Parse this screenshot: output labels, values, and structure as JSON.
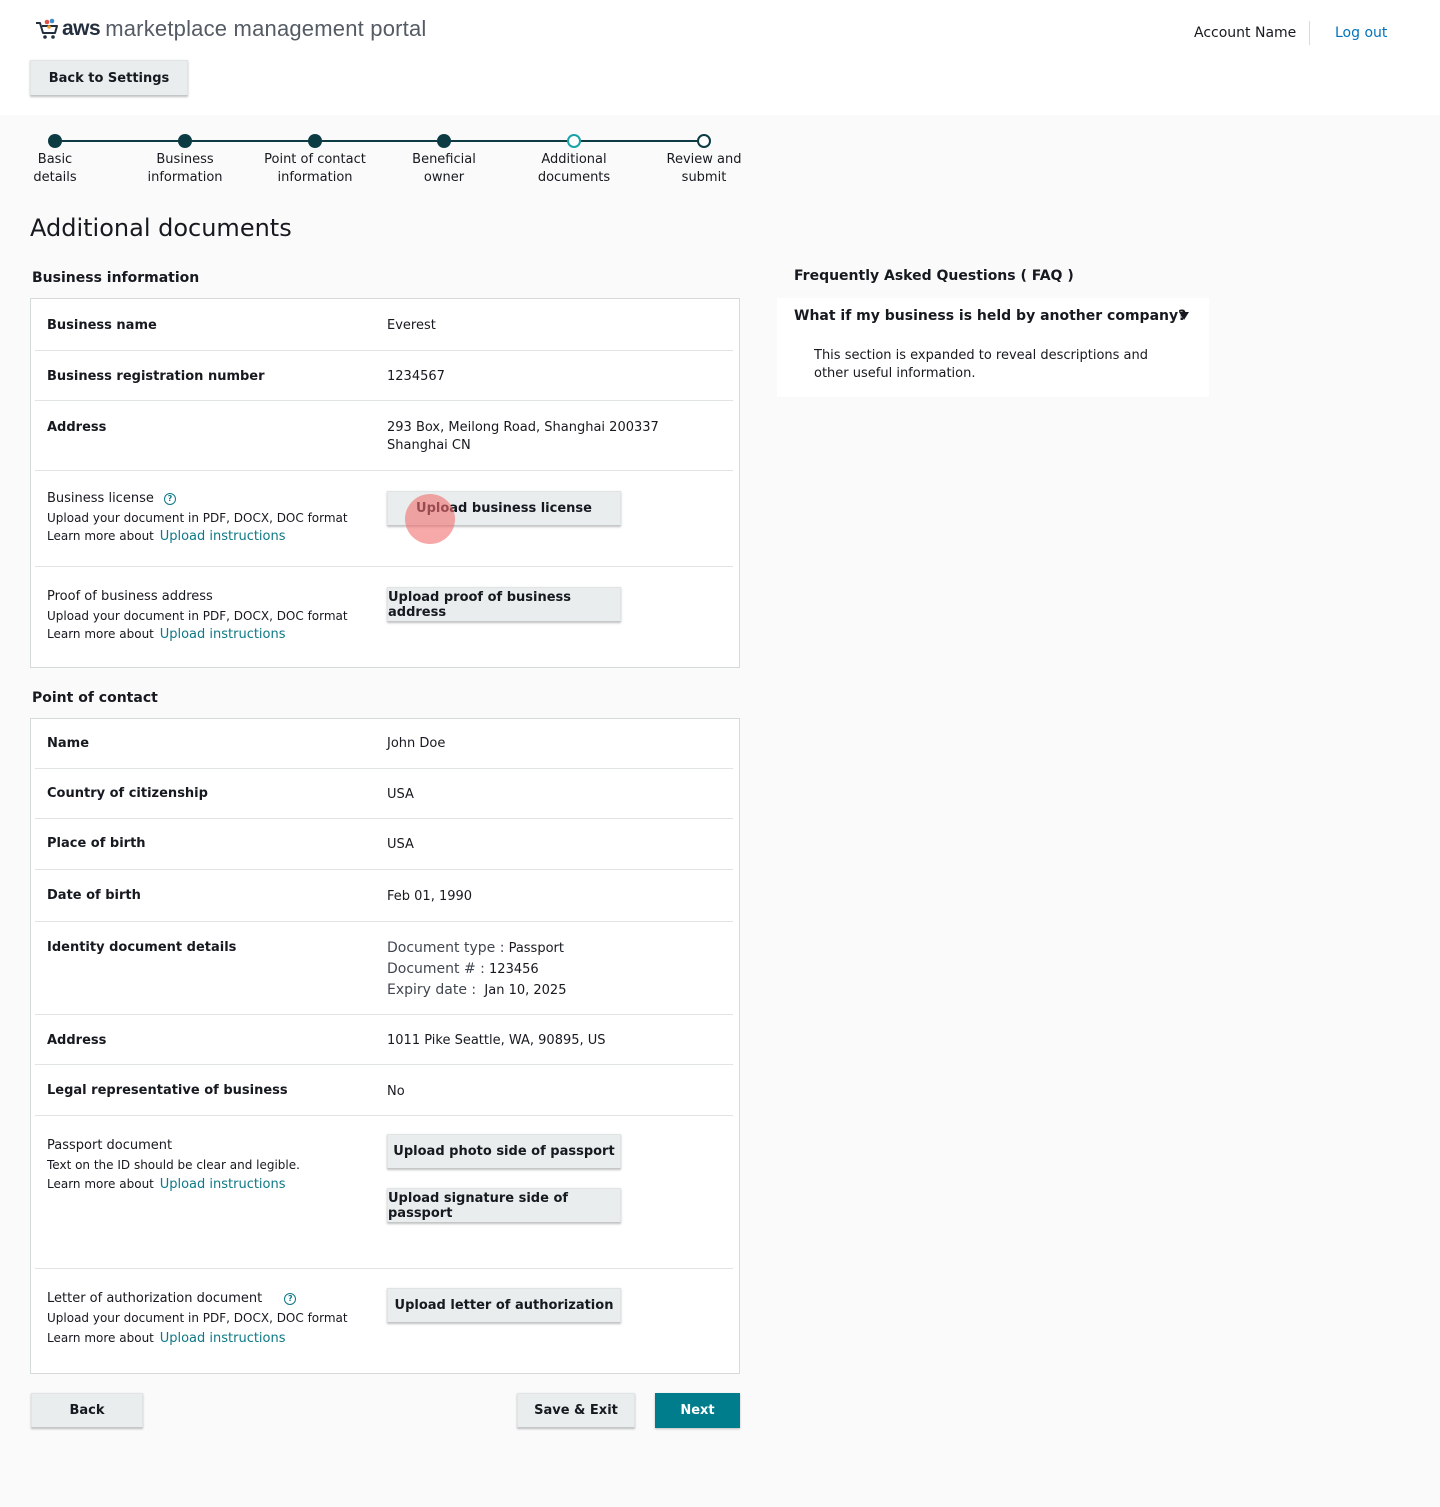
{
  "header": {
    "logo_aws": "aws",
    "logo_rest": "marketplace management portal",
    "account_name": "Account Name",
    "logout": "Log out",
    "back_to_settings": "Back to Settings"
  },
  "stepper": {
    "steps": [
      {
        "line1": "Basic",
        "line2": "details",
        "state": "done"
      },
      {
        "line1": "Business",
        "line2": "information",
        "state": "done"
      },
      {
        "line1": "Point of contact",
        "line2": "information",
        "state": "done"
      },
      {
        "line1": "Beneficial",
        "line2": "owner",
        "state": "done"
      },
      {
        "line1": "Additional",
        "line2": "documents",
        "state": "current"
      },
      {
        "line1": "Review and",
        "line2": "submit",
        "state": "future"
      }
    ]
  },
  "page_title": "Additional documents",
  "business": {
    "section_title": "Business information",
    "name_label": "Business name",
    "name_value": "Everest",
    "reg_label": "Business registration number",
    "reg_value": "1234567",
    "address_label": "Address",
    "address_line1": "293 Box, Meilong Road, Shanghai 200337",
    "address_line2": "Shanghai CN",
    "license_label": "Business license",
    "license_help": "Upload your document in PDF, DOCX, DOC format",
    "learn_more": "Learn more about",
    "upload_instructions": "Upload instructions",
    "license_button": "Upload business license",
    "proof_label": "Proof of business address",
    "proof_help": "Upload your document in PDF, DOCX, DOC format",
    "proof_button": "Upload proof of business address"
  },
  "contact": {
    "section_title": "Point of contact",
    "name_label": "Name",
    "name_value": "John Doe",
    "citizenship_label": "Country of citizenship",
    "citizenship_value": "USA",
    "birthplace_label": "Place of birth",
    "birthplace_value": "USA",
    "dob_label": "Date of birth",
    "dob_value": "Feb 01, 1990",
    "identity_label": "Identity document details",
    "doc_type_label": "Document type :",
    "doc_type_value": "Passport",
    "doc_num_label": "Document # :",
    "doc_num_value": "123456",
    "expiry_label": "Expiry date :",
    "expiry_value": "Jan 10, 2025",
    "address_label": "Address",
    "address_value": "1011 Pike Seattle, WA, 90895, US",
    "legal_label": "Legal representative of business",
    "legal_value": "No",
    "passport_label": "Passport document",
    "passport_help": "Text on the ID should be clear and legible.",
    "passport_photo_button": "Upload photo side of passport",
    "passport_sig_button": "Upload signature side of passport",
    "letter_label": "Letter of authorization document",
    "letter_help": "Upload your document in PDF, DOCX, DOC format",
    "letter_button": "Upload letter of authorization",
    "learn_more": "Learn more about",
    "upload_instructions": "Upload instructions"
  },
  "faq": {
    "title": "Frequently Asked Questions ( FAQ )",
    "question": "What if my business is held by another company?",
    "answer": "This section is expanded to reveal descriptions and other useful information."
  },
  "footer": {
    "back": "Back",
    "save_exit": "Save & Exit",
    "next": "Next"
  },
  "icons": {
    "cart": "cart-logo-icon",
    "help": "help-circle-icon",
    "caret": "caret-down-icon"
  },
  "colors": {
    "primary": "#007d8c",
    "link": "#0e7886",
    "logout_link": "#0073bb",
    "stepper": "#0d3b44",
    "current_step": "#1aa3a8"
  }
}
